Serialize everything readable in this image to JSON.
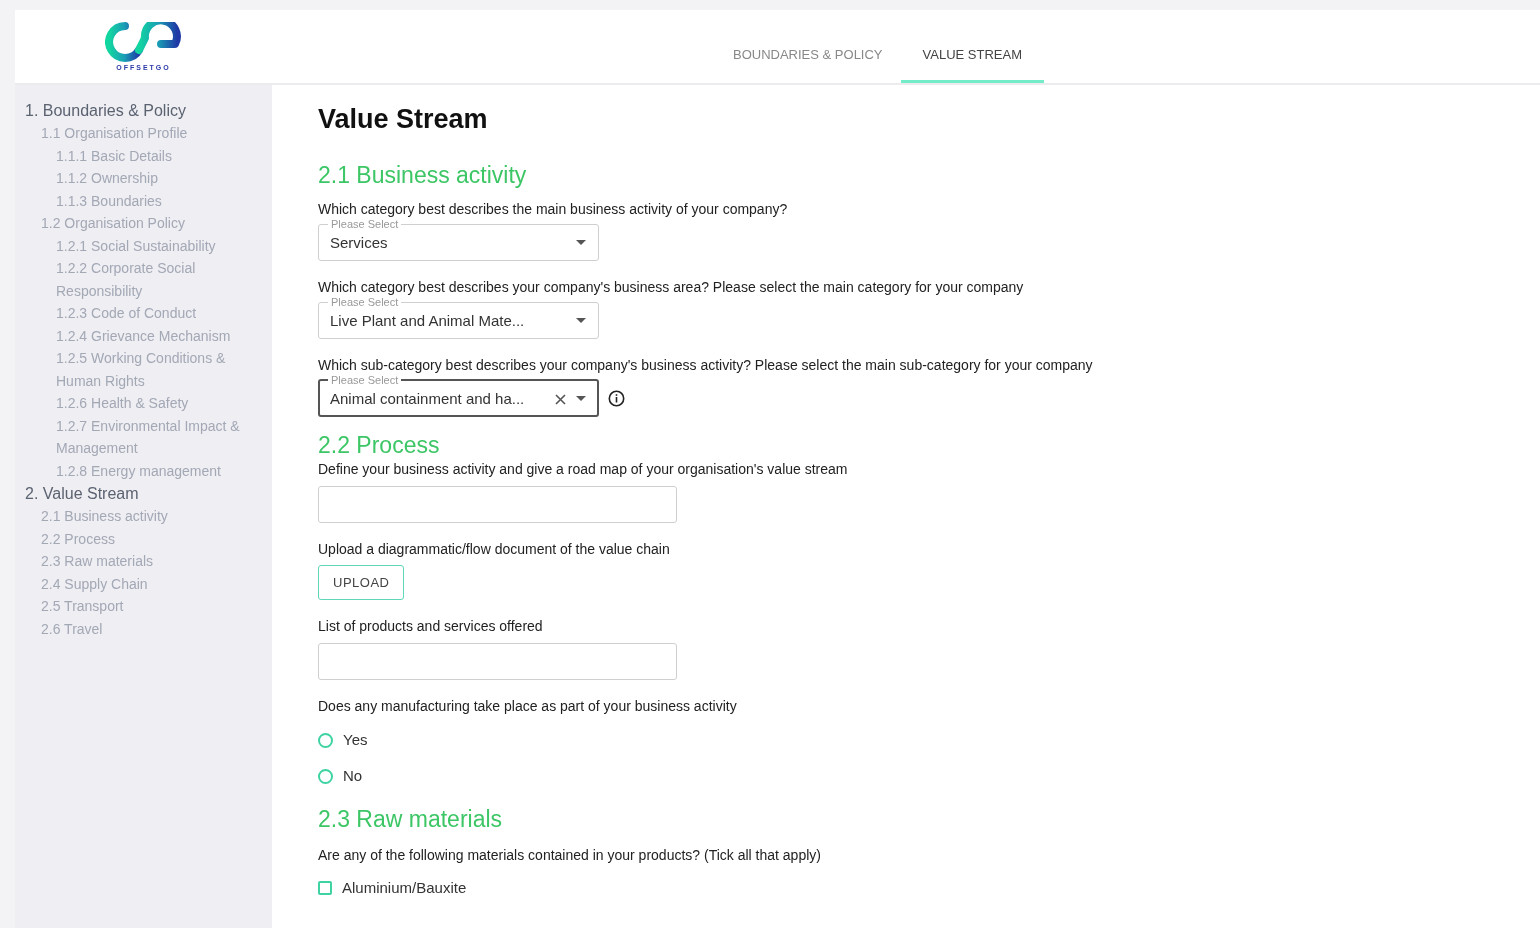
{
  "header": {
    "logo_text": "OFFSETGO",
    "tabs": [
      {
        "label": "BOUNDARIES & POLICY",
        "selected": false
      },
      {
        "label": "VALUE STREAM",
        "selected": true
      }
    ]
  },
  "sidebar": {
    "items": [
      {
        "label": "1. Boundaries & Policy",
        "children": [
          {
            "label": "1.1 Organisation Profile",
            "children": [
              {
                "label": "1.1.1 Basic Details"
              },
              {
                "label": "1.1.2 Ownership"
              },
              {
                "label": "1.1.3 Boundaries"
              }
            ]
          },
          {
            "label": "1.2 Organisation Policy",
            "children": [
              {
                "label": "1.2.1 Social Sustainability"
              },
              {
                "label": "1.2.2 Corporate Social Responsibility"
              },
              {
                "label": "1.2.3 Code of Conduct"
              },
              {
                "label": "1.2.4 Grievance Mechanism"
              },
              {
                "label": "1.2.5 Working Conditions & Human Rights"
              },
              {
                "label": "1.2.6 Health & Safety"
              },
              {
                "label": "1.2.7 Environmental Impact & Management"
              },
              {
                "label": "1.2.8 Energy management"
              }
            ]
          }
        ]
      },
      {
        "label": "2. Value Stream",
        "children": [
          {
            "label": "2.1 Business activity"
          },
          {
            "label": "2.2 Process"
          },
          {
            "label": "2.3 Raw materials"
          },
          {
            "label": "2.4 Supply Chain"
          },
          {
            "label": "2.5 Transport"
          },
          {
            "label": "2.6 Travel"
          }
        ]
      }
    ]
  },
  "main": {
    "title": "Value Stream",
    "sections": [
      {
        "heading": "2.1 Business activity",
        "questions": [
          {
            "kind": "select",
            "label": "Which category best describes the main business activity of your company?",
            "floating_label": "Please Select",
            "value": "Services",
            "clearable": false,
            "focused": false,
            "info": false
          },
          {
            "kind": "select",
            "label": "Which category best describes your company's business area? Please select the main category for your company",
            "floating_label": "Please Select",
            "value": "Live Plant and Animal Mate...",
            "clearable": false,
            "focused": false,
            "info": false
          },
          {
            "kind": "select",
            "label": "Which sub-category best describes your company's business activity? Please select the main sub-category for your company",
            "floating_label": "Please Select",
            "value": "Animal containment and ha...",
            "clearable": true,
            "focused": true,
            "info": true
          }
        ]
      },
      {
        "heading": "2.2 Process",
        "questions": [
          {
            "kind": "text",
            "label": "Define your business activity and give a road map of your organisation's value stream"
          },
          {
            "kind": "upload",
            "label": "Upload a diagrammatic/flow document of the value chain",
            "button": "UPLOAD"
          },
          {
            "kind": "text",
            "label": "List of products and services offered"
          },
          {
            "kind": "radio",
            "label": "Does any manufacturing take place as part of your business activity",
            "options": [
              {
                "label": "Yes",
                "selected": false
              },
              {
                "label": "No",
                "selected": false
              }
            ]
          }
        ]
      },
      {
        "heading": "2.3 Raw materials",
        "questions": [
          {
            "kind": "checkbox",
            "label": "Are any of the following materials contained in your products? (Tick all that apply)",
            "options": [
              {
                "label": "Aluminium/Bauxite",
                "checked": false
              }
            ]
          }
        ]
      }
    ]
  }
}
